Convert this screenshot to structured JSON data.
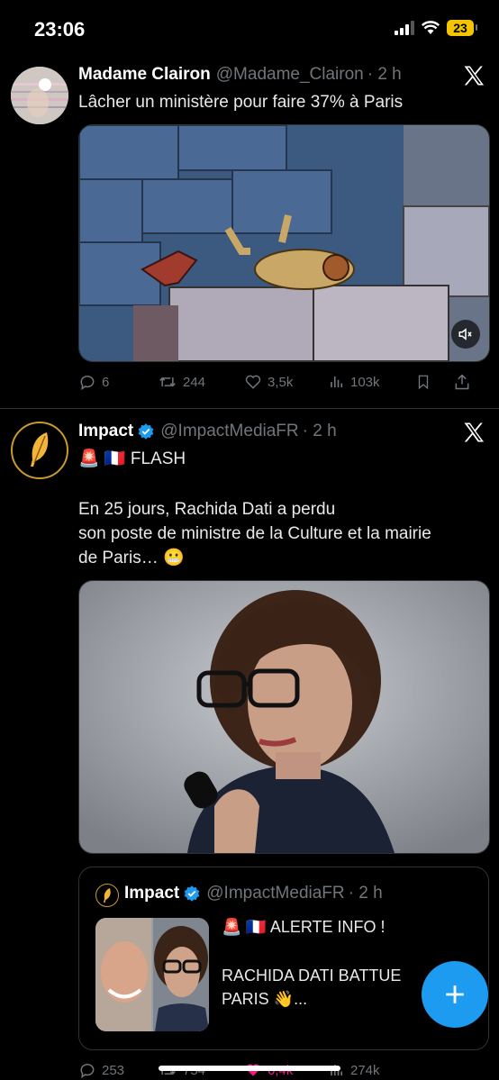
{
  "status": {
    "time": "23:06",
    "battery": "23"
  },
  "tweets": [
    {
      "name": "Madame Clairon",
      "handle": "@Madame_Clairon",
      "time": "· 2 h",
      "text": "Lâcher un ministère pour faire 37% à Paris",
      "media_desc": "cartoon",
      "stats": {
        "replies": "6",
        "retweets": "244",
        "likes": "3,5k",
        "views": "103k"
      }
    },
    {
      "name": "Impact",
      "handle": "@ImpactMediaFR",
      "time": "· 2 h",
      "flash": "🚨 🇫🇷 FLASH",
      "text": "En 25 jours, Rachida Dati a perdu\nson poste de ministre de la Culture et la mairie\nde Paris… 😬",
      "quote": {
        "name": "Impact",
        "handle": "@ImpactMediaFR",
        "time": "· 2 h",
        "line1": "🚨 🇫🇷 ALERTE INFO !",
        "line2": "RACHIDA DATI BATTUE",
        "line3": "PARIS 👋..."
      },
      "stats": {
        "replies": "253",
        "retweets": "754",
        "likes": "6,4k",
        "views": "274k"
      }
    }
  ],
  "colors": {
    "accent": "#1d9bf0",
    "like": "#f91880",
    "muted": "#71767b"
  }
}
